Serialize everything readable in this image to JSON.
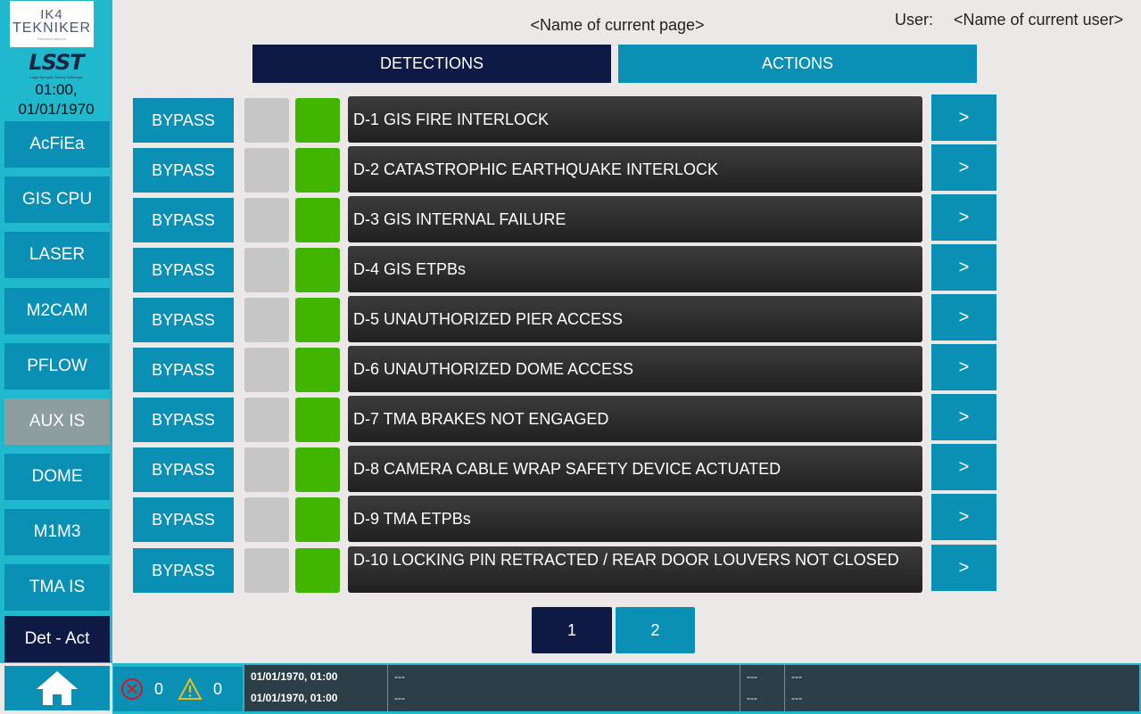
{
  "sidebar": {
    "logo_ik4_line1": "IK4",
    "logo_ik4_line2": "TEKNIKER",
    "logo_ik4_tagline": "Research Alliance",
    "logo_lsst_word": "LSST",
    "logo_lsst_tagline": "Large Synoptic Survey Telescope",
    "clock_time": "01:00,",
    "clock_date": "01/01/1970",
    "items": [
      {
        "label": "AcFiEa",
        "state": "normal"
      },
      {
        "label": "GIS CPU",
        "state": "normal"
      },
      {
        "label": "LASER",
        "state": "normal"
      },
      {
        "label": "M2CAM",
        "state": "normal"
      },
      {
        "label": "PFLOW",
        "state": "normal"
      },
      {
        "label": "AUX IS",
        "state": "disabled"
      },
      {
        "label": "DOME",
        "state": "normal"
      },
      {
        "label": "M1M3",
        "state": "normal"
      },
      {
        "label": "TMA IS",
        "state": "normal"
      },
      {
        "label": "Det - Act",
        "state": "active"
      }
    ],
    "home_icon": "home-icon"
  },
  "header": {
    "page_title": "<Name of current page>",
    "user_label": "User:",
    "user_name": "<Name of current user>"
  },
  "tabs": [
    {
      "label": "DETECTIONS",
      "active": true
    },
    {
      "label": "ACTIONS",
      "active": false
    }
  ],
  "rows": [
    {
      "bypass": "BYPASS",
      "label": "D-1 GIS FIRE INTERLOCK",
      "arrow": ">",
      "indicator_gray": "#c6c6c6",
      "indicator_green": "#41b400"
    },
    {
      "bypass": "BYPASS",
      "label": "D-2 CATASTROPHIC EARTHQUAKE INTERLOCK",
      "arrow": ">"
    },
    {
      "bypass": "BYPASS",
      "label": "D-3 GIS INTERNAL FAILURE",
      "arrow": ">"
    },
    {
      "bypass": "BYPASS",
      "label": "D-4 GIS ETPBs",
      "arrow": ">"
    },
    {
      "bypass": "BYPASS",
      "label": "D-5 UNAUTHORIZED PIER ACCESS",
      "arrow": ">"
    },
    {
      "bypass": "BYPASS",
      "label": "D-6 UNAUTHORIZED DOME ACCESS",
      "arrow": ">"
    },
    {
      "bypass": "BYPASS",
      "label": "D-7 TMA BRAKES NOT ENGAGED",
      "arrow": ">"
    },
    {
      "bypass": "BYPASS",
      "label": "D-8 CAMERA CABLE WRAP SAFETY DEVICE ACTUATED",
      "arrow": ">"
    },
    {
      "bypass": "BYPASS",
      "label": "D-9 TMA ETPBs",
      "arrow": ">"
    },
    {
      "bypass": "BYPASS",
      "label": "D-10 LOCKING PIN RETRACTED / REAR DOOR LOUVERS NOT CLOSED",
      "arrow": ">"
    }
  ],
  "pagination": {
    "pages": [
      "1",
      "2"
    ],
    "current": "1"
  },
  "statusbar": {
    "error_icon": "error-icon",
    "error_count": "0",
    "warning_icon": "warning-icon",
    "warning_count": "0",
    "log": [
      {
        "timestamp": "01/01/1970, 01:00",
        "message": "---",
        "code": "---",
        "detail": "---"
      },
      {
        "timestamp": "01/01/1970, 01:00",
        "message": "---",
        "code": "---",
        "detail": "---"
      }
    ]
  },
  "colors": {
    "accent": "#0a8fb5",
    "sidebar_bg": "#1fb8cd",
    "active_navy": "#0e1a44",
    "disabled_gray": "#8e9e9f",
    "ok_green": "#41b400",
    "neutral_gray": "#c6c6c6"
  }
}
